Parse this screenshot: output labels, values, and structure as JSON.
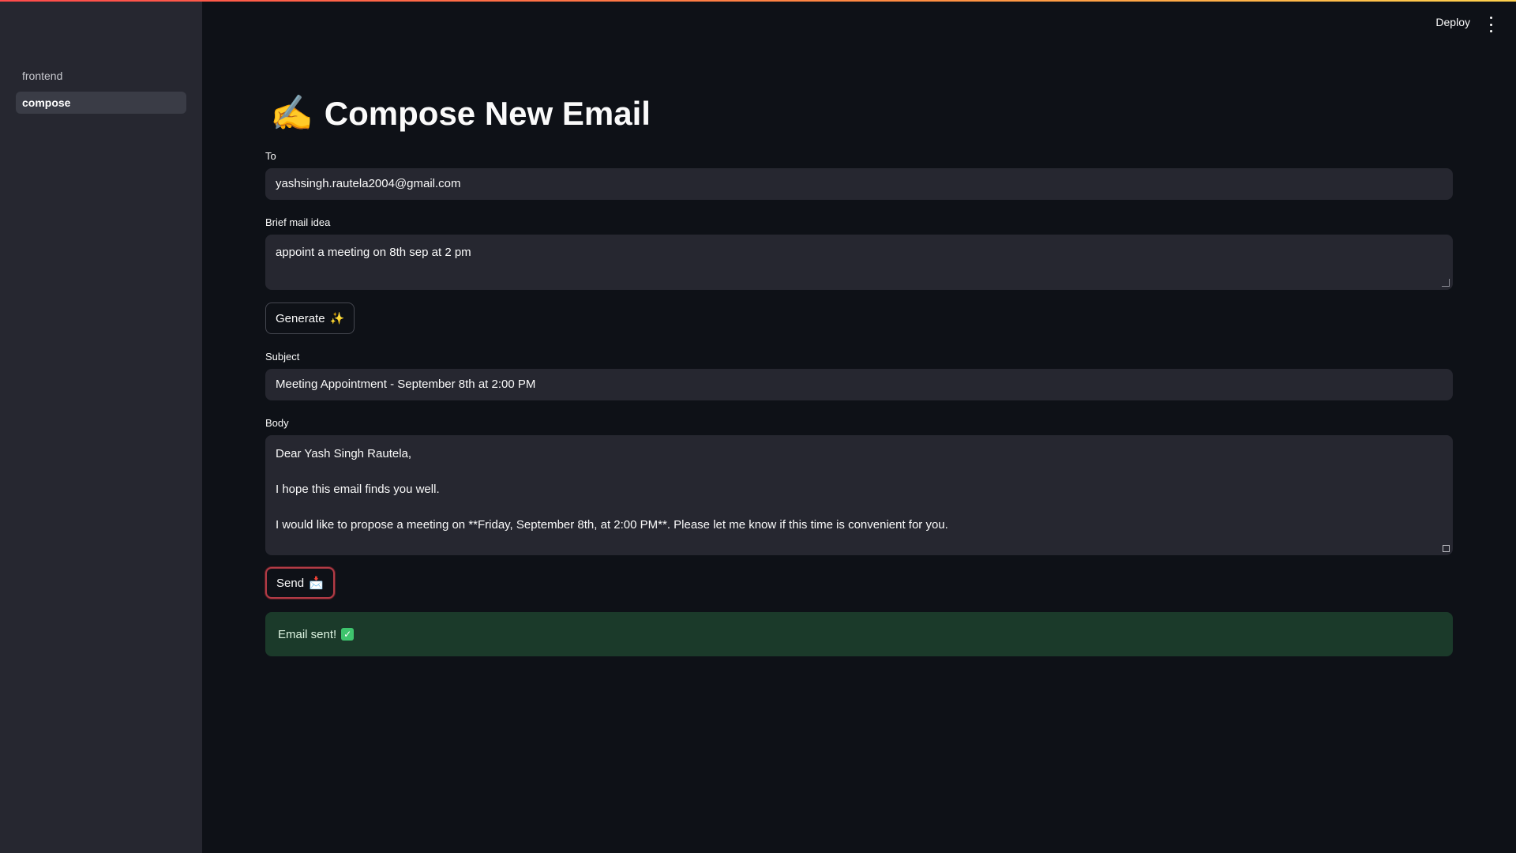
{
  "sidebar": {
    "items": [
      {
        "label": "frontend",
        "active": false
      },
      {
        "label": "compose",
        "active": true
      }
    ]
  },
  "header": {
    "deploy_label": "Deploy",
    "menu_icon": "kebab-menu-icon"
  },
  "page": {
    "title_icon": "✍️",
    "title": "Compose New Email"
  },
  "form": {
    "to": {
      "label": "To",
      "value": "yashsingh.rautela2004@gmail.com"
    },
    "idea": {
      "label": "Brief mail idea",
      "value": "appoint a meeting on 8th sep at 2 pm"
    },
    "generate_button": {
      "label": "Generate",
      "icon": "✨"
    },
    "subject": {
      "label": "Subject",
      "value": "Meeting Appointment - September 8th at 2:00 PM"
    },
    "body": {
      "label": "Body",
      "value": "Dear Yash Singh Rautela,\n\nI hope this email finds you well.\n\nI would like to propose a meeting on **Friday, September 8th, at 2:00 PM**. Please let me know if this time is convenient for you."
    },
    "send_button": {
      "label": "Send",
      "icon": "📩"
    }
  },
  "status": {
    "message": "Email sent!",
    "icon": "✓",
    "color": "#1b3a2a"
  },
  "colors": {
    "background": "#0e1117",
    "sidebar": "#262730",
    "accent": "#ff4b4b"
  }
}
